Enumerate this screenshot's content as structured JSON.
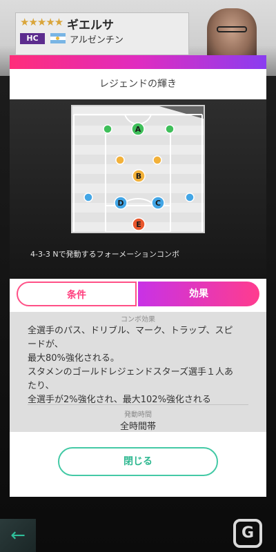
{
  "player": {
    "stars": "★★★★★",
    "name": "ギエルサ",
    "role_badge": "HC",
    "country": "アルゼンチン"
  },
  "modal": {
    "title": "レジェンドの輝き",
    "combo_caption": "4-3-3 Nで発動するフォーメーションコンボ",
    "tabs": [
      {
        "label": "条件",
        "selected": false
      },
      {
        "label": "効果",
        "selected": true
      }
    ],
    "effect_section_label": "コンボ効果",
    "effect_lines": [
      "全選手のパス、ドリブル、マーク、トラップ、スピ",
      "ードが、",
      "最大80%強化される。",
      "スタメンのゴールドレジェンドスターズ選手１人あ",
      "たり、",
      "全選手が2%強化され、最大102%強化される"
    ],
    "time_section_label": "発動時間",
    "time_value": "全時間帯",
    "close_label": "閉じる"
  },
  "formation": {
    "labels": {
      "A": "A",
      "B": "B",
      "C": "C",
      "D": "D",
      "E": "E"
    },
    "colors": {
      "green": "#3fbf5a",
      "yellow": "#f2b13a",
      "blue": "#43a6e6",
      "red": "#e9572d"
    }
  },
  "nav": {
    "back_icon": "←"
  },
  "watermark": "G"
}
